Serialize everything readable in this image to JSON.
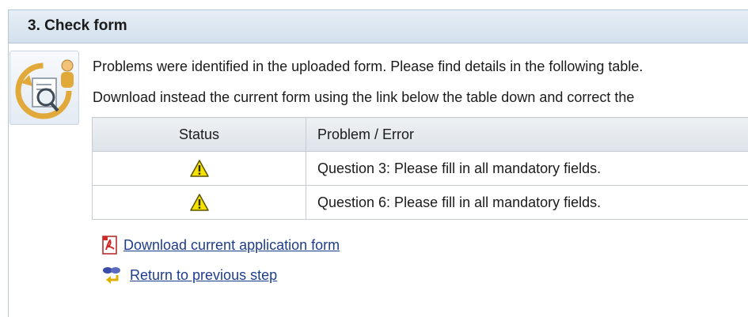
{
  "panel": {
    "title": "3. Check form"
  },
  "message": {
    "line1": "Problems were identified in the uploaded form. Please find details in the following table.",
    "line2": "Download instead the current form using the link below the table down and correct the"
  },
  "table": {
    "headers": [
      "Status",
      "Problem / Error"
    ],
    "rows": [
      {
        "status_icon": "warning-icon",
        "problem": "Question 3: Please fill in all mandatory fields."
      },
      {
        "status_icon": "warning-icon",
        "problem": "Question 6: Please fill in all mandatory fields."
      }
    ]
  },
  "links": {
    "download": {
      "label": "Download current application form",
      "icon": "pdf-icon"
    },
    "return": {
      "label": "Return to previous step",
      "icon": "return-step-icon"
    }
  },
  "colors": {
    "link": "#1d3d8c",
    "warning": "#f5e200",
    "header_bg": "#d3e0ec"
  }
}
